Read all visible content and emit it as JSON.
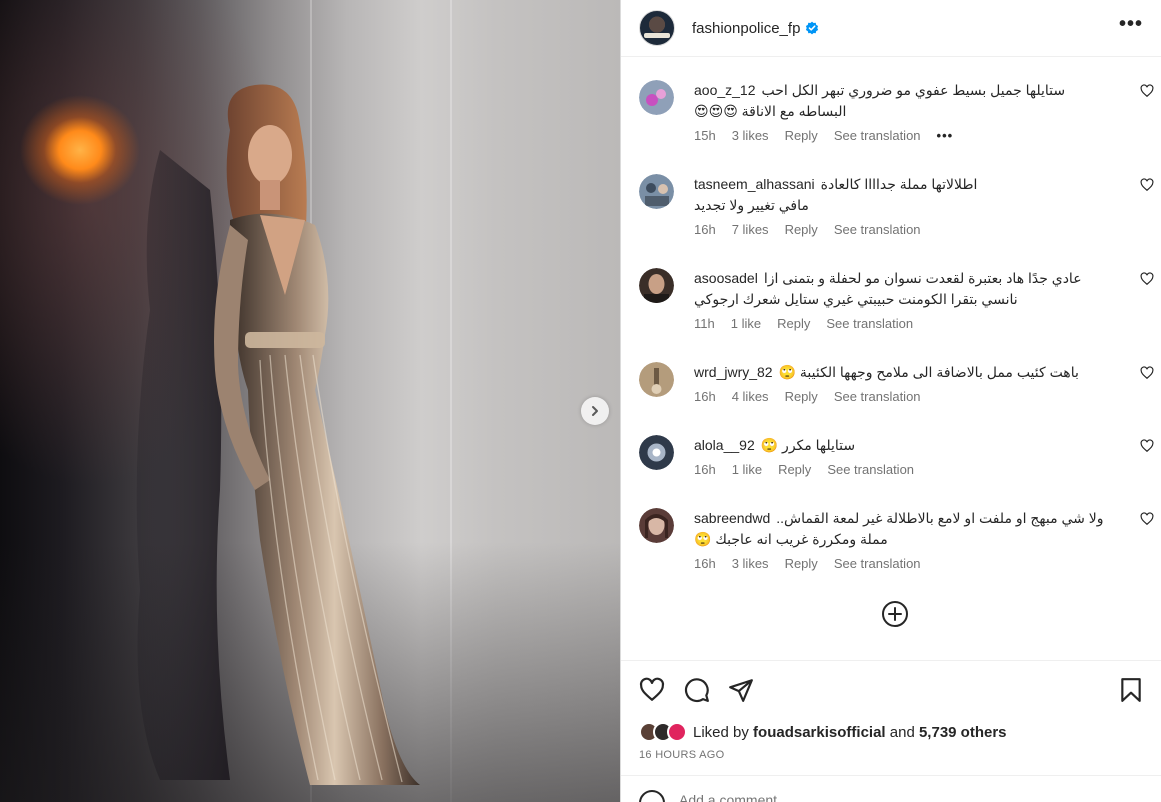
{
  "post": {
    "username": "fashionpolice_fp",
    "verified_icon": "verified-badge-icon",
    "more_icon": "more-options-icon",
    "more_label": "•••"
  },
  "media": {
    "next_icon": "chevron-right-icon"
  },
  "comments": [
    {
      "username": "aoo_z_12",
      "text": "ستايلها جميل بسيط عفوي مو ضروري تبهر الكل احب البساطه مع الاناقة 😍😍😍",
      "time": "15h",
      "likes": "3 likes",
      "reply": "Reply",
      "translate": "See translation",
      "more": "•••",
      "avatar_color": "#8fa0b8",
      "avatar_accent": "#c850c0"
    },
    {
      "username": "tasneem_alhassani",
      "text": "اطلالاتها مملة جداااا كالعادة\nمافي تغيير ولا تجديد",
      "time": "16h",
      "likes": "7 likes",
      "reply": "Reply",
      "translate": "See translation",
      "avatar_color": "#7a8fa6",
      "avatar_accent": "#3d4c5e"
    },
    {
      "username": "asoosadel",
      "text": "عادي جدًا هاد بعتبرة لقعدت نسوان مو لحفلة و بتمنى ازا نانسي بتقرا الكومنت حبيبتي غيري ستايل شعرك ارجوكي",
      "time": "11h",
      "likes": "1 like",
      "reply": "Reply",
      "translate": "See translation",
      "avatar_color": "#9a8474",
      "avatar_accent": "#3a2e28"
    },
    {
      "username": "wrd_jwry_82",
      "text": "باهت كئيب ممل بالاضافة الى ملامح وجهها الكئيبة 🙄",
      "time": "16h",
      "likes": "4 likes",
      "reply": "Reply",
      "translate": "See translation",
      "avatar_color": "#b49c7c",
      "avatar_accent": "#6d5a44"
    },
    {
      "username": "alola__92",
      "text": "ستايلها مكرر 🙄",
      "time": "16h",
      "likes": "1 like",
      "reply": "Reply",
      "translate": "See translation",
      "avatar_color": "#2f3a4a",
      "avatar_accent": "#c7d4e6"
    },
    {
      "username": "sabreendwd",
      "text": "ولا شي مبهج او ملفت او لامع بالاطلالة غير لمعة القماش.. مملة ومكررة غريب انه عاجبك 🙄",
      "time": "16h",
      "likes": "3 likes",
      "reply": "Reply",
      "translate": "See translation",
      "avatar_color": "#5a3c38",
      "avatar_accent": "#d8b7a6"
    }
  ],
  "load_more_icon": "plus-circle-icon",
  "actions": {
    "like_icon": "heart-icon",
    "comment_icon": "comment-bubble-icon",
    "share_icon": "send-icon",
    "save_icon": "bookmark-icon"
  },
  "likes": {
    "prefix": "Liked by",
    "user": "fouadsarkisofficial",
    "and": "and",
    "others": "5,739 others"
  },
  "timestamp": "16 HOURS AGO",
  "add_comment": {
    "placeholder": "Add a comment…",
    "emoji_icon": "emoji-icon"
  },
  "colors": {
    "verified": "#0095f6",
    "text": "#262626",
    "secondary": "#737373",
    "border": "#dbdbdb"
  }
}
